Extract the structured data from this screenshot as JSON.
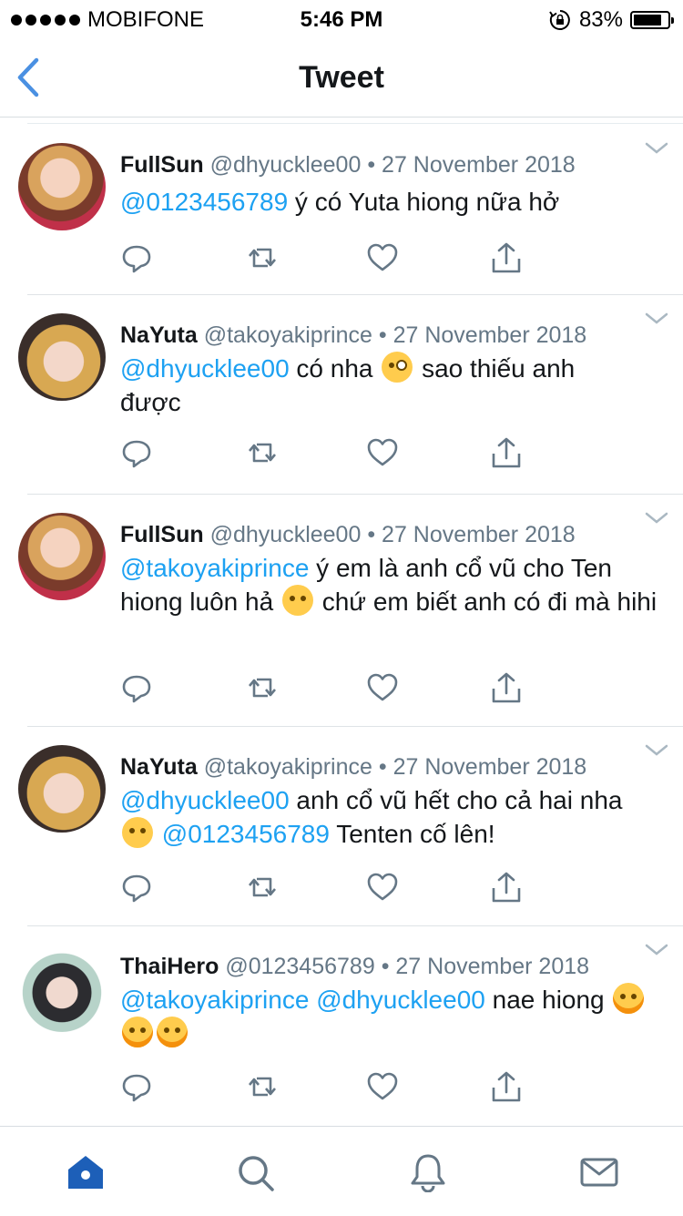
{
  "status_bar": {
    "carrier": "MOBIFONE",
    "time": "5:46 PM",
    "battery_percent": "83%",
    "battery_level": 0.83
  },
  "nav": {
    "title": "Tweet",
    "back_icon": "chevron-left-icon"
  },
  "colors": {
    "accent": "#1da1f2",
    "nav_blue": "#4a90e2",
    "meta_gray": "#657786",
    "tab_active": "#1d5fb8"
  },
  "tweets": [
    {
      "name": "FullSun",
      "handle": "@dhyucklee00",
      "sep": "•",
      "date": "27 November 2018",
      "parts": [
        {
          "t": "@0123456789",
          "mention": true
        },
        {
          "t": " ý có Yuta hiong nữa hở",
          "mention": false
        }
      ]
    },
    {
      "name": "NaYuta",
      "handle": "@takoyakiprince",
      "sep": "•",
      "date": "27 November 2018",
      "parts": [
        {
          "t": "@dhyucklee00",
          "mention": true
        },
        {
          "t": " có nha ",
          "mention": false
        },
        {
          "emoji": "winking-face-with-tongue"
        },
        {
          "t": " sao thiếu anh được",
          "mention": false
        }
      ]
    },
    {
      "name": "FullSun",
      "handle": "@dhyucklee00",
      "sep": "•",
      "date": "27 November 2018",
      "parts": [
        {
          "t": "@takoyakiprince",
          "mention": true
        },
        {
          "t": " ý em là anh cổ vũ cho Ten hiong luôn hả ",
          "mention": false
        },
        {
          "emoji": "relieved-face"
        },
        {
          "t": " chứ em biết anh có đi mà hihi",
          "mention": false
        }
      ]
    },
    {
      "name": "NaYuta",
      "handle": "@takoyakiprince",
      "sep": "•",
      "date": "27 November 2018",
      "parts": [
        {
          "t": "@dhyucklee00",
          "mention": true
        },
        {
          "t": " anh cổ vũ hết cho cả hai nha ",
          "mention": false
        },
        {
          "emoji": "unamused-face"
        },
        {
          "t": " ",
          "mention": false
        },
        {
          "t": "@0123456789",
          "mention": true
        },
        {
          "t": " Tenten cố lên!",
          "mention": false
        }
      ]
    },
    {
      "name": "ThaiHero",
      "handle": "@0123456789",
      "sep": "•",
      "date": "27 November 2018",
      "parts": [
        {
          "t": "@takoyakiprince",
          "mention": true
        },
        {
          "t": " ",
          "mention": false
        },
        {
          "t": "@dhyucklee00",
          "mention": true
        },
        {
          "t": " nae hiong ",
          "mention": false
        },
        {
          "emoji": "face-with-tears-of-joy"
        },
        {
          "emoji": "face-with-tears-of-joy"
        },
        {
          "emoji": "face-with-tears-of-joy"
        }
      ]
    }
  ],
  "action_icons": [
    "reply-icon",
    "retweet-icon",
    "like-icon",
    "share-icon"
  ],
  "tab_bar": {
    "tabs": [
      "home-icon",
      "search-icon",
      "notifications-icon",
      "messages-icon"
    ],
    "active": "home-icon"
  }
}
